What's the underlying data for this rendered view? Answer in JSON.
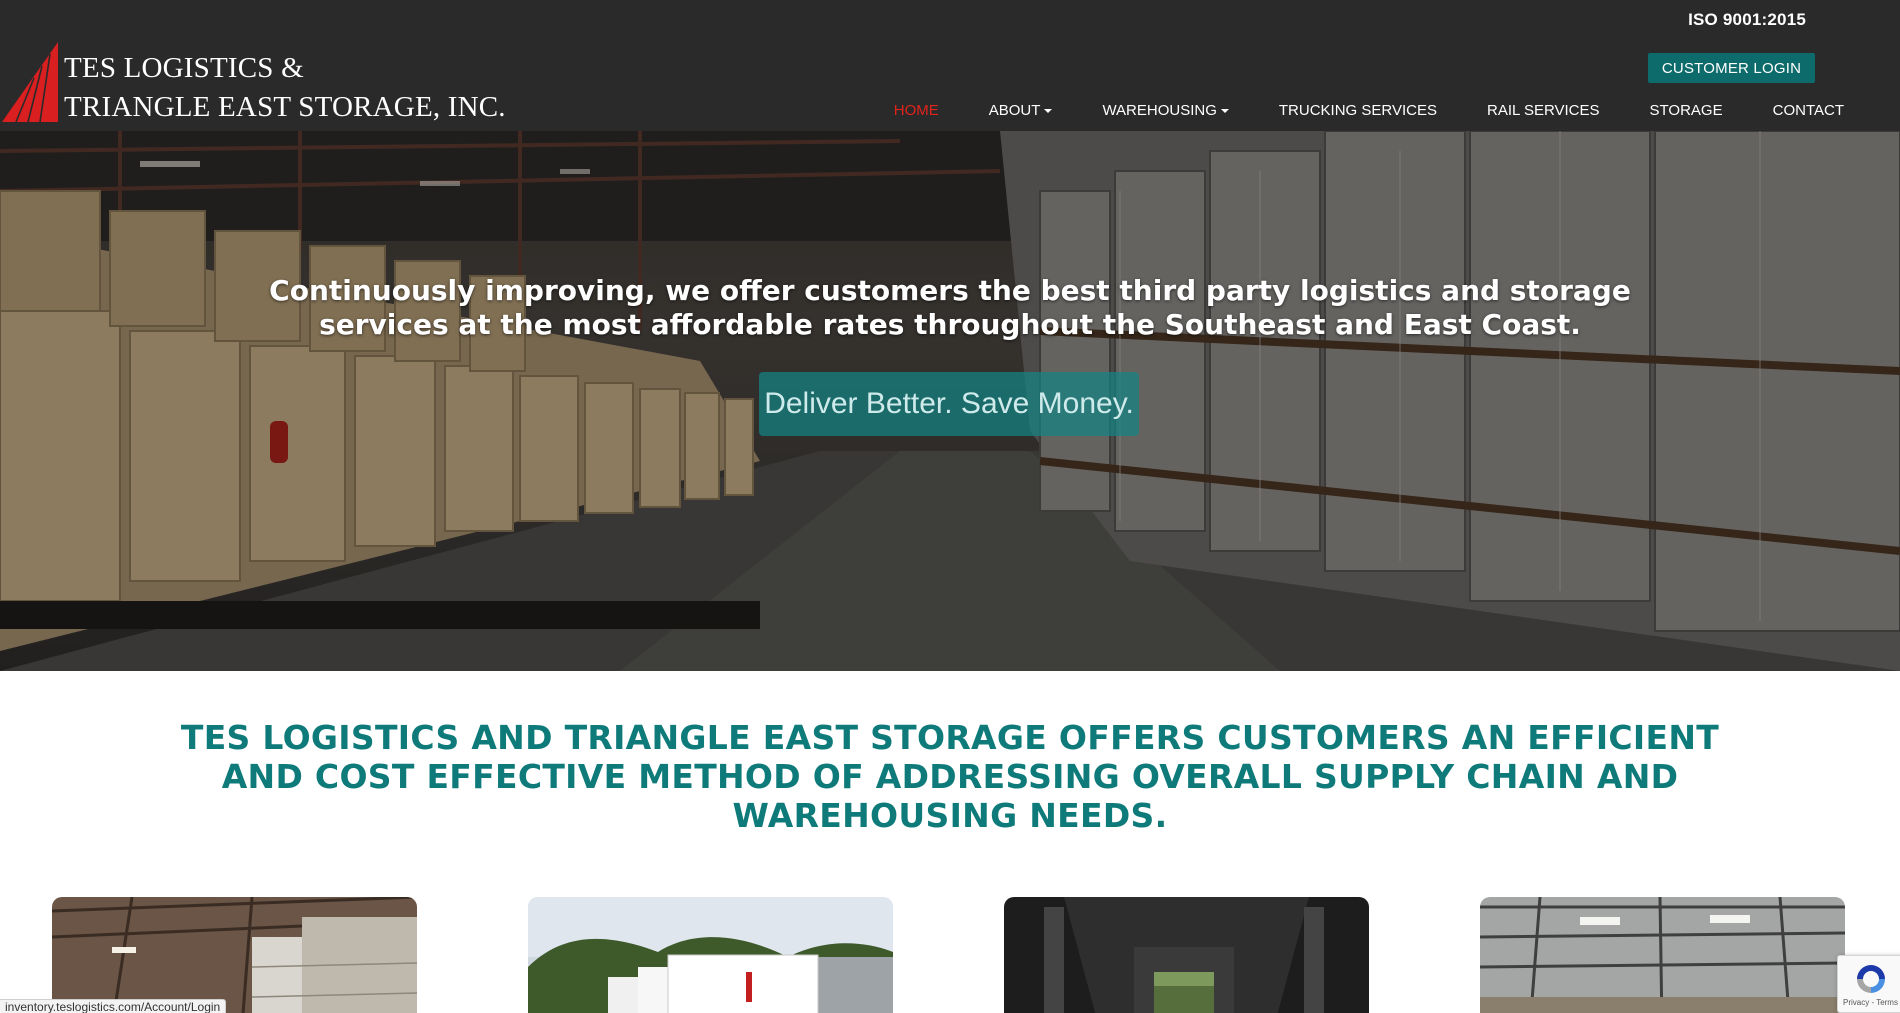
{
  "header": {
    "logo_line1": "TES LOGISTICS &",
    "logo_line2": "TRIANGLE EAST STORAGE, INC.",
    "iso": "ISO 9001:2015",
    "login_label": "CUSTOMER LOGIN",
    "nav": [
      {
        "label": "HOME",
        "active": true
      },
      {
        "label": "ABOUT",
        "dropdown": true
      },
      {
        "label": "WAREHOUSING",
        "dropdown": true
      },
      {
        "label": "TRUCKING SERVICES"
      },
      {
        "label": "RAIL SERVICES"
      },
      {
        "label": "STORAGE"
      },
      {
        "label": "CONTACT"
      }
    ]
  },
  "hero": {
    "headline": "Continuously improving, we offer customers the best third party logistics and storage services at the most affordable rates throughout the Southeast and East Coast.",
    "cta": "Deliver Better. Save Money."
  },
  "mission": "TES LOGISTICS AND TRIANGLE EAST STORAGE OFFERS CUSTOMERS AN EFFICIENT AND COST EFFECTIVE METHOD OF ADDRESSING OVERALL SUPPLY CHAIN AND WAREHOUSING NEEDS.",
  "status_bar": "inventory.teslogistics.com/Account/Login",
  "recaptcha": {
    "terms": "Privacy - Terms"
  },
  "colors": {
    "header_bg": "#2a2a2a",
    "accent_teal": "#0e6b6b",
    "mission_teal": "#0e7a7a",
    "nav_active": "#e0241c",
    "logo_red": "#d91f1f"
  },
  "icons": {
    "logo": "red-triangle-logo-icon",
    "nav_caret": "caret-down-icon",
    "recaptcha": "recaptcha-icon"
  }
}
